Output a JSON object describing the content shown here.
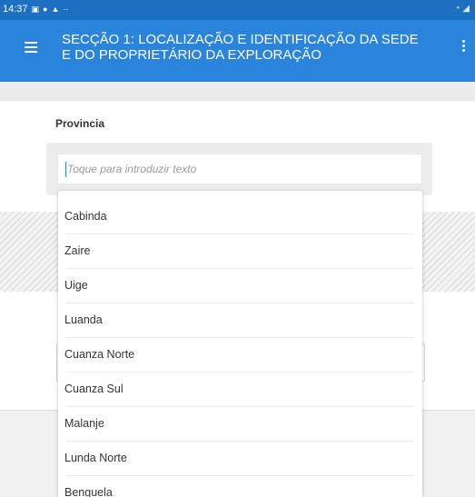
{
  "status_bar": {
    "time": "14:37",
    "left_icons": [
      "image-icon",
      "dot-icon",
      "warning-icon",
      "more-dots-icon"
    ],
    "right_icons": [
      "wifi-icon",
      "signal-icon"
    ]
  },
  "app_bar": {
    "title": "SECÇÃO 1: LOCALIZAÇÃO E IDENTIFICAÇÃO DA SEDE E DO PROPRIETÁRIO DA EXPLORAÇÃO",
    "menu_icon": "hamburger-menu-icon",
    "more_icon": "more-vert-icon",
    "background": "#2a84dc"
  },
  "form": {
    "field_label": "Provincia",
    "input_placeholder": "Toque para introduzir texto",
    "input_value": ""
  },
  "dropdown": {
    "options": [
      "Cabinda",
      "Zaire",
      "Uige",
      "Luanda",
      "Cuanza Norte",
      "Cuanza Sul",
      "Malanje",
      "Lunda Norte",
      "Benguela"
    ]
  }
}
